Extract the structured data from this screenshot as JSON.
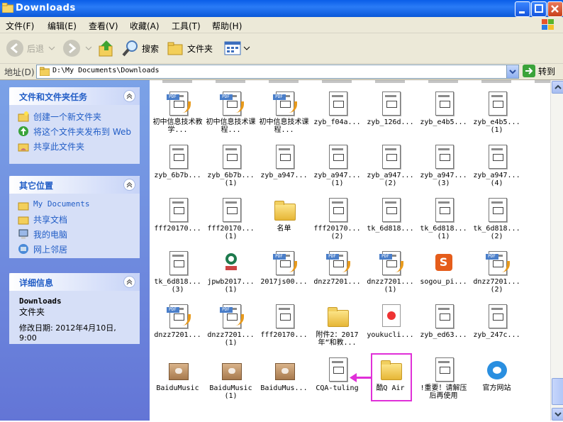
{
  "window": {
    "title": "Downloads"
  },
  "menu": [
    {
      "label": "文件(F)"
    },
    {
      "label": "编辑(E)"
    },
    {
      "label": "查看(V)"
    },
    {
      "label": "收藏(A)"
    },
    {
      "label": "工具(T)"
    },
    {
      "label": "帮助(H)"
    }
  ],
  "toolbar": {
    "back_label": "后退",
    "search_label": "搜索",
    "folders_label": "文件夹"
  },
  "address": {
    "label": "地址(D)",
    "value": "D:\\My Documents\\Downloads",
    "go_label": "转到"
  },
  "sidebar": {
    "tasks": {
      "title": "文件和文件夹任务",
      "items": [
        {
          "label": "创建一个新文件夹"
        },
        {
          "label": "将这个文件夹发布到 Web"
        },
        {
          "label": "共享此文件夹"
        }
      ]
    },
    "places": {
      "title": "其它位置",
      "items": [
        {
          "label": "My Documents"
        },
        {
          "label": "共享文档"
        },
        {
          "label": "我的电脑"
        },
        {
          "label": "网上邻居"
        }
      ]
    },
    "details": {
      "title": "详细信息",
      "name": "Downloads",
      "type": "文件夹",
      "modified": "修改日期: 2012年4月10日, 9:00"
    }
  },
  "files": [
    {
      "name": "初中信息技术教学...",
      "icon": "pdf-icon"
    },
    {
      "name": "初中信息技术课程...",
      "icon": "pdf-icon"
    },
    {
      "name": "初中信息技术课程...",
      "icon": "pdf-icon"
    },
    {
      "name": "zyb_f04a...",
      "icon": "document-icon"
    },
    {
      "name": "zyb_126d...",
      "icon": "document-icon"
    },
    {
      "name": "zyb_e4b5...",
      "icon": "document-icon"
    },
    {
      "name": "zyb_e4b5... (1)",
      "icon": "document-icon"
    },
    {
      "name": "zyb_6b7b...",
      "icon": "document-icon"
    },
    {
      "name": "zyb_6b7b... (1)",
      "icon": "document-icon"
    },
    {
      "name": "zyb_a947...",
      "icon": "document-icon"
    },
    {
      "name": "zyb_a947... (1)",
      "icon": "document-icon"
    },
    {
      "name": "zyb_a947... (2)",
      "icon": "document-icon"
    },
    {
      "name": "zyb_a947... (3)",
      "icon": "document-icon"
    },
    {
      "name": "zyb_a947... (4)",
      "icon": "document-icon"
    },
    {
      "name": "fff20170...",
      "icon": "document-icon"
    },
    {
      "name": "fff20170... (1)",
      "icon": "document-icon"
    },
    {
      "name": "名单",
      "icon": "folder-icon"
    },
    {
      "name": "fff20170... (2)",
      "icon": "document-icon"
    },
    {
      "name": "tk_6d818...",
      "icon": "document-icon"
    },
    {
      "name": "tk_6d818... (1)",
      "icon": "document-icon"
    },
    {
      "name": "tk_6d818... (2)",
      "icon": "document-icon"
    },
    {
      "name": "tk_6d818... (3)",
      "icon": "document-icon"
    },
    {
      "name": "jpwb2017... (1)",
      "icon": "app-icon"
    },
    {
      "name": "2017js00...",
      "icon": "pdf-icon"
    },
    {
      "name": "dnzz7201...",
      "icon": "pdf-icon"
    },
    {
      "name": "dnzz7201... (1)",
      "icon": "pdf-icon"
    },
    {
      "name": "sogou_pi...",
      "icon": "sogou-icon"
    },
    {
      "name": "dnzz7201... (2)",
      "icon": "pdf-icon"
    },
    {
      "name": "dnzz7201...",
      "icon": "pdf-icon"
    },
    {
      "name": "dnzz7201... (1)",
      "icon": "pdf-icon"
    },
    {
      "name": "fff20170...",
      "icon": "document-icon"
    },
    {
      "name": "附件2：2017年“和教...",
      "icon": "folder-icon"
    },
    {
      "name": "youkucli...",
      "icon": "video-icon"
    },
    {
      "name": "zyb_ed63...",
      "icon": "document-icon"
    },
    {
      "name": "zyb_247c...",
      "icon": "document-icon"
    },
    {
      "name": "BaiduMusic",
      "icon": "package-icon"
    },
    {
      "name": "BaiduMusic (1)",
      "icon": "package-icon"
    },
    {
      "name": "BaiduMus...",
      "icon": "package-icon"
    },
    {
      "name": "CQA-tuling",
      "icon": "document-icon"
    },
    {
      "name": "酷Q Air",
      "icon": "folder-icon"
    },
    {
      "name": "!重要！请解压后再使用",
      "icon": "document-icon"
    },
    {
      "name": "官方网站",
      "icon": "cloud-icon"
    }
  ],
  "colors": {
    "accent": "#215dc6",
    "highlight": "#e030d8",
    "titlebar": "#0a5ee8"
  }
}
